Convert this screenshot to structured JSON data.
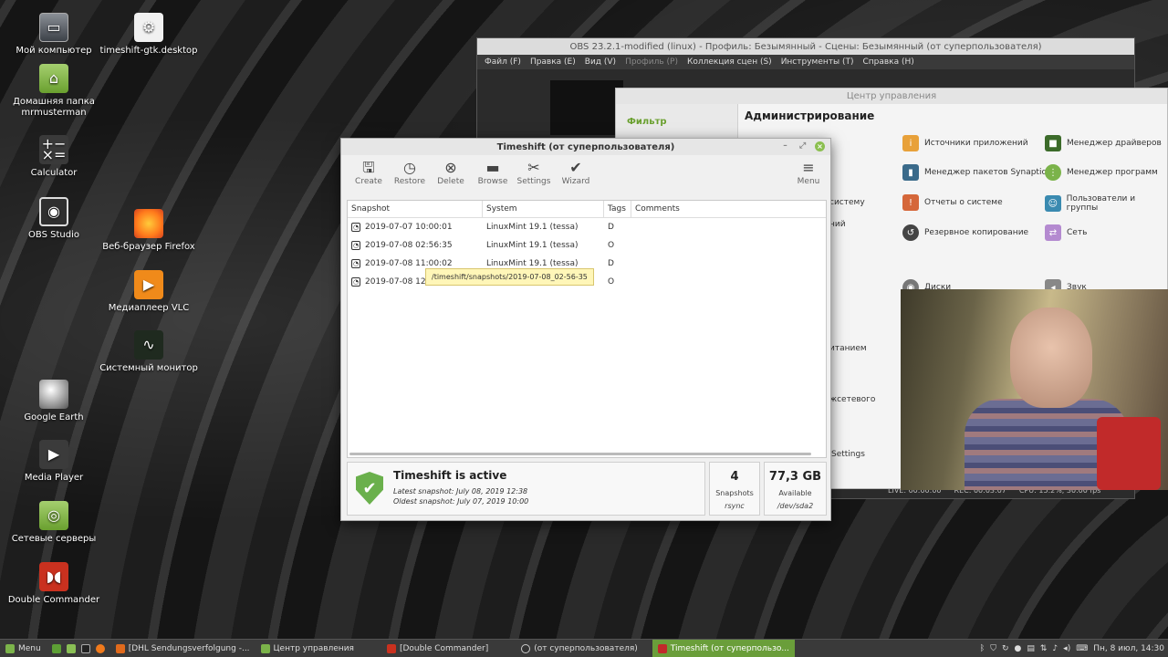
{
  "desktop_icons": [
    {
      "label": "Мой компьютер",
      "icon": "computer-icon"
    },
    {
      "label": "Домашняя папка mrmusterman",
      "icon": "home-folder-icon"
    },
    {
      "label": "Calculator",
      "icon": "calculator-icon"
    },
    {
      "label": "OBS Studio",
      "icon": "obs-icon"
    },
    {
      "label": "Google Earth",
      "icon": "google-earth-icon"
    },
    {
      "label": "Media Player",
      "icon": "media-player-icon"
    },
    {
      "label": "Сетевые серверы",
      "icon": "network-folder-icon"
    },
    {
      "label": "Double Commander",
      "icon": "double-commander-icon"
    },
    {
      "label": "timeshift-gtk.desktop",
      "icon": "gear-icon"
    },
    {
      "label": "Веб-браузер Firefox",
      "icon": "firefox-icon"
    },
    {
      "label": "Медиаплеер VLC",
      "icon": "vlc-icon"
    },
    {
      "label": "Системный монитор",
      "icon": "system-monitor-icon"
    }
  ],
  "obs": {
    "title": "OBS 23.2.1-modified (linux) - Профиль: Безымянный - Сцены: Безымянный (от суперпользователя)",
    "menu": [
      "Файл (F)",
      "Правка (E)",
      "Вид (V)",
      "Профиль (P)",
      "Коллекция сцен (S)",
      "Инструменты (T)",
      "Справка (H)"
    ],
    "status": [
      "LIVE: 00:00:00",
      "REC: 00:03:07",
      "CPU: 15.2%, 30.00 fps"
    ]
  },
  "control_center": {
    "title": "Центр управления",
    "filter_label": "Фильтр",
    "heading": "Администрирование",
    "items": [
      "Источники приложений",
      "Менеджер драйверов",
      "Менеджер пакетов Synaptic",
      "Менеджер программ",
      "Отчеты о системе",
      "Пользователи и группы",
      "Резервное копирование",
      "Сеть",
      "Диски",
      "Звук"
    ],
    "partial": [
      "новлений",
      "систему",
      "итанием",
      "жсетевого",
      "Settings"
    ]
  },
  "timeshift": {
    "title": "Timeshift (от суперпользователя)",
    "toolbar": {
      "create": "Create",
      "restore": "Restore",
      "delete": "Delete",
      "browse": "Browse",
      "settings": "Settings",
      "wizard": "Wizard",
      "menu": "Menu"
    },
    "columns": {
      "snapshot": "Snapshot",
      "system": "System",
      "tags": "Tags",
      "comments": "Comments"
    },
    "rows": [
      {
        "snapshot": "2019-07-07 10:00:01",
        "system": "LinuxMint 19.1 (tessa)",
        "tags": "D"
      },
      {
        "snapshot": "2019-07-08 02:56:35",
        "system": "LinuxMint 19.1 (tessa)",
        "tags": "O"
      },
      {
        "snapshot": "2019-07-08 11:00:02",
        "system": "LinuxMint 19.1 (tessa)",
        "tags": "D"
      },
      {
        "snapshot": "2019-07-08 12:3",
        "system": "",
        "tags": "O"
      }
    ],
    "tooltip": "/timeshift/snapshots/2019-07-08_02-56-35",
    "status": {
      "title": "Timeshift is active",
      "latest": "Latest snapshot: July 08, 2019 12:38",
      "oldest": "Oldest snapshot: July 07, 2019 10:00"
    },
    "snapshots": {
      "count": "4",
      "label": "Snapshots",
      "type": "rsync"
    },
    "space": {
      "value": "77,3 GB",
      "label": "Available",
      "device": "/dev/sda2"
    }
  },
  "taskbar": {
    "menu_label": "Menu",
    "windows": [
      "[DHL Sendungsverfolgung -...",
      "Центр управления",
      "[Double Commander]",
      "(от суперпользователя)",
      "Timeshift (от суперпользо..."
    ],
    "clock": "Пн, 8 июл, 14:30"
  },
  "colors": {
    "accent": "#6a9e3a",
    "shield": "#6ab04c",
    "tooltip": "#fff6b8"
  }
}
